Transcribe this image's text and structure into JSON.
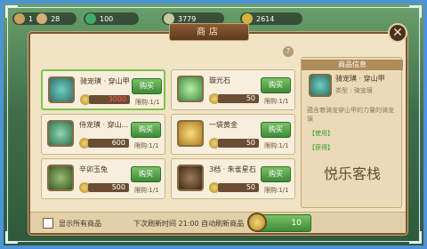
{
  "topbar": {
    "level": "1",
    "energy": "28",
    "jade": "100",
    "silver": "3779",
    "gold": "2614"
  },
  "panel": {
    "title": "商店",
    "help": "?",
    "close": "✕"
  },
  "items": [
    {
      "name": "骑宠璜 · 穿山甲",
      "price": "3000",
      "price_red": true,
      "buy": "购买",
      "limit": "限购:1/1",
      "icon_color": "#3aa6a0"
    },
    {
      "name": "璇光石",
      "price": "50",
      "price_red": false,
      "buy": "购买",
      "limit": "限购:1/1",
      "icon_color": "#7ad07a"
    },
    {
      "name": "侍宠璜 · 穿山...",
      "price": "600",
      "price_red": false,
      "buy": "购买",
      "limit": "限购:1/1",
      "icon_color": "#4ea07a"
    },
    {
      "name": "一袋黄金",
      "price": "50",
      "price_red": false,
      "buy": "购买",
      "limit": "限购:1/1",
      "icon_color": "#d8a93a"
    },
    {
      "name": "辛卯玉兔",
      "price": "500",
      "price_red": false,
      "buy": "购买",
      "limit": "限购:1/1",
      "icon_color": "#4a6a3a"
    },
    {
      "name": "3档 · 朱雀星石",
      "price": "50",
      "price_red": false,
      "buy": "购买",
      "limit": "限购:1/1",
      "icon_color": "#6a4a3a"
    }
  ],
  "info": {
    "title": "商品信息",
    "name": "骑宠璜 · 穿山甲",
    "type": "类型 : 骑宠璜",
    "desc": "蕴含着骑宠穿山甲的力量的骑宠璜",
    "use": "【使用】",
    "get": "【获得】",
    "watermark": "悦乐客栈"
  },
  "bottom": {
    "show_all": "显示所有商品",
    "refresh_text": "下次刷新时间 21:00 自动刷新商品",
    "refresh_cost": "10"
  }
}
